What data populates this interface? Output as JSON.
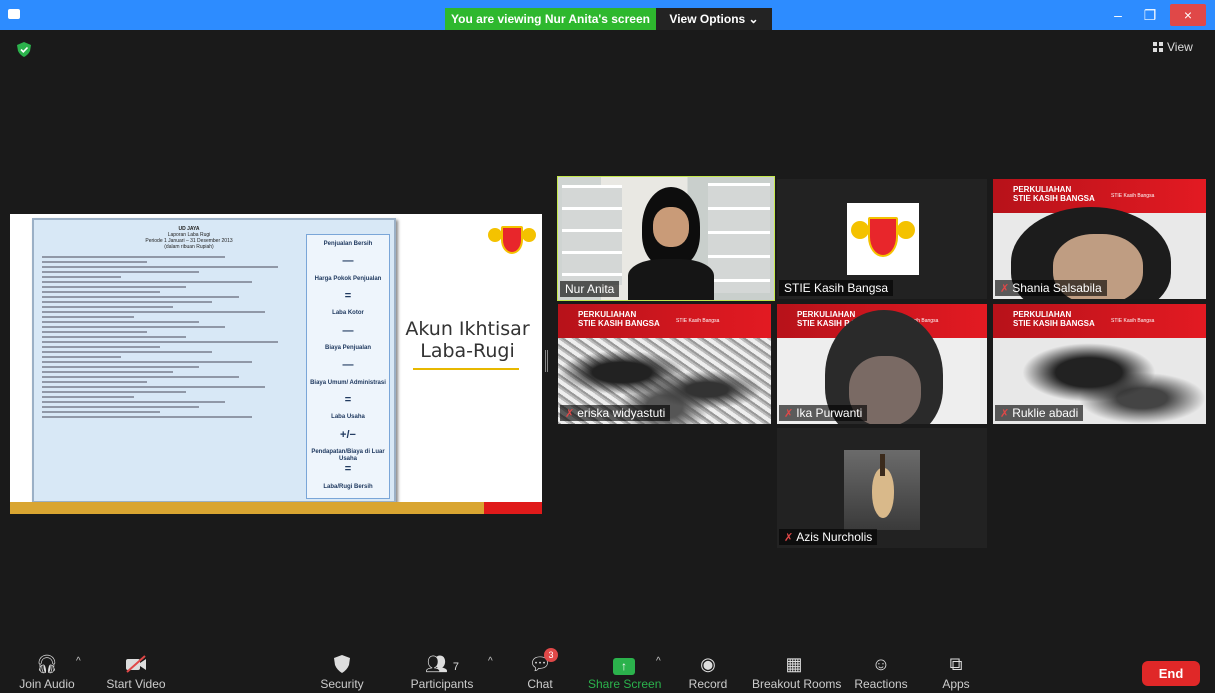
{
  "banner": {
    "viewing_text": "You are viewing Nur Anita's screen",
    "view_options_label": "View Options ⌄"
  },
  "window": {
    "minimize": "–",
    "restore": "❐",
    "close": "×"
  },
  "view_button": {
    "label": "View"
  },
  "slide": {
    "doc_title_lines": [
      "UD JAYA",
      "Laporan Laba Rugi",
      "Periode 1 Januari – 31 Desember 2013",
      "(dalam ribuan Rupiah)"
    ],
    "flow_steps": [
      "Penjualan Bersih",
      "—",
      "Harga Pokok Penjualan",
      "=",
      "Laba Kotor",
      "—",
      "Biaya Penjualan",
      "—",
      "Biaya Umum/ Administrasi",
      "=",
      "Laba Usaha",
      "+/−",
      "Pendapatan/Biaya di Luar Usaha",
      "=",
      "Laba/Rugi Bersih"
    ],
    "title_line1": "Akun Ikhtisar",
    "title_line2": "Laba-Rugi"
  },
  "tiles": [
    {
      "name": "Nur Anita",
      "muted": false,
      "active": true
    },
    {
      "name": "STIE Kasih Bangsa",
      "muted": false,
      "active": false
    },
    {
      "name": "Shania Salsabila",
      "muted": true,
      "active": false
    },
    {
      "name": "eriska widyastuti",
      "muted": true,
      "active": false
    },
    {
      "name": "Ika Purwanti",
      "muted": true,
      "active": false
    },
    {
      "name": "Ruklie abadi",
      "muted": true,
      "active": false
    },
    {
      "name": "Azis Nurcholis",
      "muted": true,
      "active": false
    }
  ],
  "red_header": {
    "line1": "PERKULIAHAN",
    "line2": "STIE KASIH BANGSA",
    "small": "STIE Kasih Bangsa"
  },
  "toolbar": {
    "join_audio": "Join Audio",
    "start_video": "Start Video",
    "security": "Security",
    "participants": "Participants",
    "participants_count": "7",
    "chat": "Chat",
    "chat_badge": "3",
    "share_screen": "Share Screen",
    "record": "Record",
    "breakout_rooms": "Breakout Rooms",
    "reactions": "Reactions",
    "apps": "Apps",
    "end": "End"
  },
  "colors": {
    "zoom_blue": "#2d8cff",
    "banner_green": "#2eb82e",
    "active_outline": "#c4e84c",
    "end_red": "#e02828"
  }
}
